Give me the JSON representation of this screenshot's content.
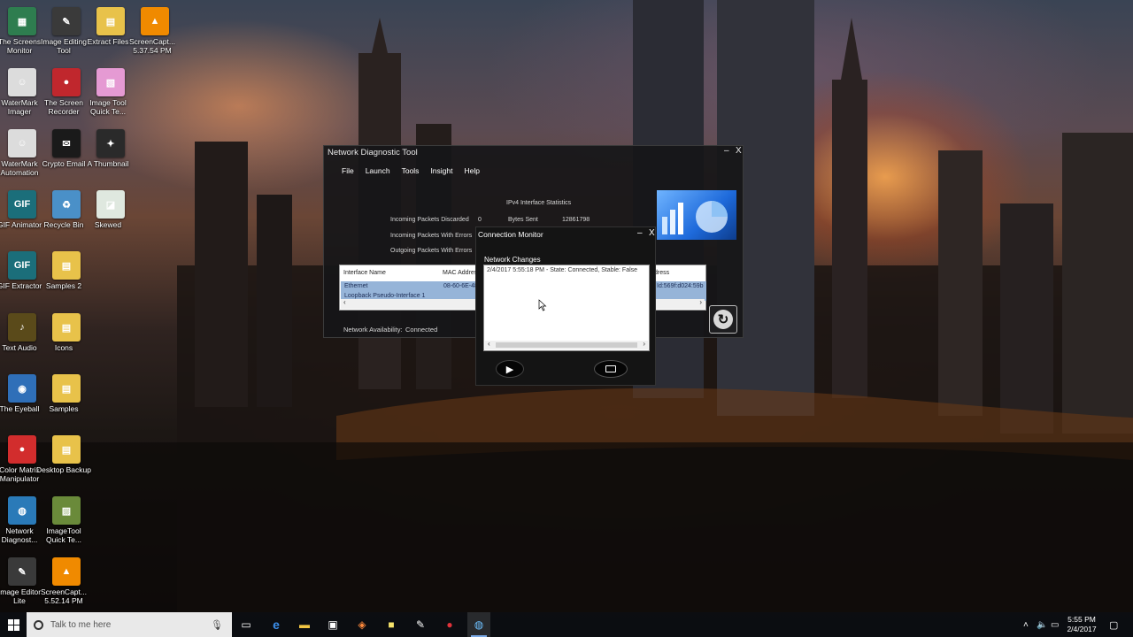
{
  "desktop_icons": [
    {
      "label": "The Screens Monitor",
      "glyph": "▦",
      "color": "#2e7d4f"
    },
    {
      "label": "Image Editing Tool",
      "glyph": "✎",
      "color": "#3a3a3a"
    },
    {
      "label": "Extract Files",
      "glyph": "▤",
      "color": "#e8c24a"
    },
    {
      "label": "ScreenCapt... 5.37.54 PM",
      "glyph": "▲",
      "color": "#f08a00"
    },
    {
      "label": "WaterMark Imager",
      "glyph": "☺",
      "color": "#dcdcdc"
    },
    {
      "label": "The Screen Recorder",
      "glyph": "●",
      "color": "#c0272d"
    },
    {
      "label": "Image Tool Quick Te...",
      "glyph": "▧",
      "color": "#e59ad3"
    },
    {
      "label": "WaterMark Automation",
      "glyph": "☺",
      "color": "#dcdcdc"
    },
    {
      "label": "Crypto Email",
      "glyph": "✉",
      "color": "#1a1a1a"
    },
    {
      "label": "A Thumbnail",
      "glyph": "✦",
      "color": "#2a2a2a"
    },
    {
      "label": "GIF Animator",
      "glyph": "GIF",
      "color": "#1b6e7a"
    },
    {
      "label": "Recycle Bin",
      "glyph": "♻",
      "color": "#4a90c8"
    },
    {
      "label": "Skewed",
      "glyph": "◪",
      "color": "#dfe8df"
    },
    {
      "label": "GIF Extractor",
      "glyph": "GIF",
      "color": "#1b6e7a"
    },
    {
      "label": "Samples 2",
      "glyph": "▤",
      "color": "#e8c24a"
    },
    {
      "label": "Text Audio",
      "glyph": "♪",
      "color": "#5a4a1a"
    },
    {
      "label": "Icons",
      "glyph": "▤",
      "color": "#e8c24a"
    },
    {
      "label": "The Eyeball",
      "glyph": "◉",
      "color": "#2f6fb8"
    },
    {
      "label": "Samples",
      "glyph": "▤",
      "color": "#e8c24a"
    },
    {
      "label": "Color Matrix Manipulator",
      "glyph": "●",
      "color": "#d22d2d"
    },
    {
      "label": "Desktop Backup",
      "glyph": "▤",
      "color": "#e8c24a"
    },
    {
      "label": "Network Diagnost...",
      "glyph": "◍",
      "color": "#2a7ab8"
    },
    {
      "label": "ImageTool Quick Te...",
      "glyph": "▨",
      "color": "#6a8a3a"
    },
    {
      "label": "Image Editor Lite",
      "glyph": "✎",
      "color": "#3a3a3a"
    },
    {
      "label": "ScreenCapt... 5.52.14 PM",
      "glyph": "▲",
      "color": "#f08a00"
    }
  ],
  "main_window": {
    "title": "Network Diagnostic Tool",
    "minimize": "–",
    "close": "X",
    "menu": [
      "File",
      "Launch",
      "Tools",
      "Insight",
      "Help"
    ],
    "stats_heading": "IPv4 Interface Statistics",
    "incoming_discarded_label": "Incoming Packets Discarded",
    "incoming_discarded_value": "0",
    "bytes_sent_label": "Bytes Sent",
    "bytes_sent_value": "12861798",
    "incoming_errors_label": "Incoming Packets With Errors",
    "outgoing_errors_label": "Outgoing Packets With Errors",
    "grid": {
      "col_interface": "Interface Name",
      "col_mac": "MAC Address",
      "col_address_tail": "dress",
      "rows": [
        {
          "name": "Ethernet",
          "mac": "08-60-6E-48",
          "addr": "Id:569f:d024:59b"
        },
        {
          "name": "Loopback Pseudo-Interface 1",
          "mac": "",
          "addr": ""
        }
      ]
    },
    "availability_label": "Network Availability:",
    "availability_value": "Connected"
  },
  "monitor": {
    "title": "Connection Monitor",
    "minimize": "–",
    "close": "X",
    "section": "Network Changes",
    "entries": [
      "2/4/2017 5:55:18 PM - State: Connected, Stable: False"
    ]
  },
  "taskbar": {
    "search_placeholder": "Talk to me here",
    "time": "5:55 PM",
    "date": "2/4/2017"
  }
}
